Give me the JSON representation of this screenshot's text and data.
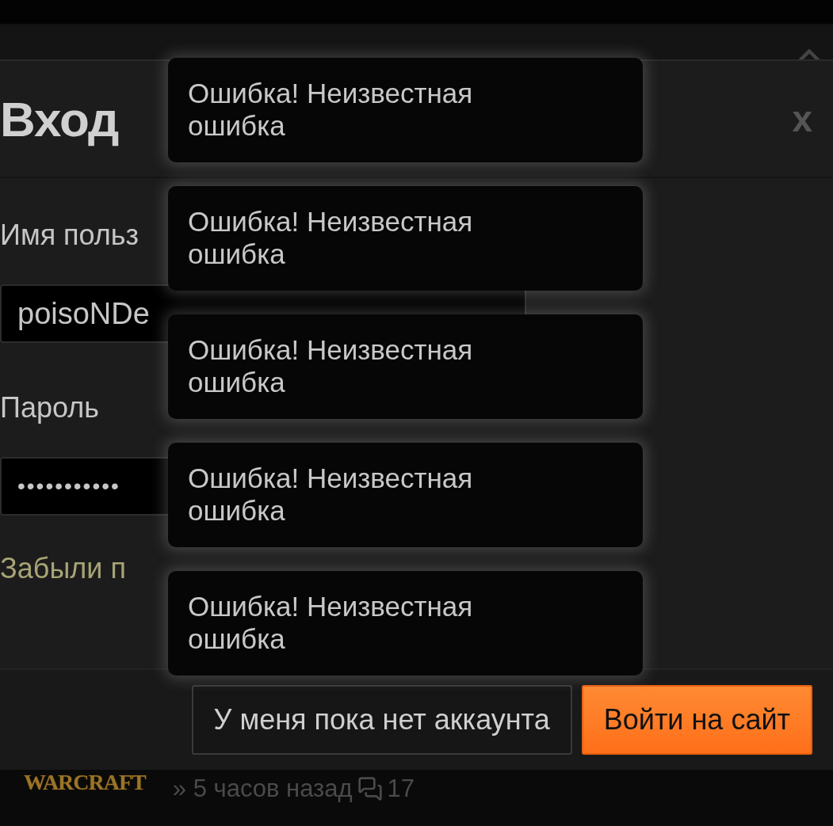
{
  "modal": {
    "title": "Вход",
    "close": "x",
    "fields": [
      {
        "kind": "text",
        "label": "Имя польз",
        "value": "poisoNDe"
      },
      {
        "kind": "password",
        "label": "Пароль",
        "value": "•••••••••••"
      }
    ],
    "forgot_link": "Забыли п",
    "buttons": [
      {
        "kind": "secondary",
        "label": "У меня пока нет аккаунта"
      },
      {
        "kind": "primary",
        "label": "Войти на сайт"
      }
    ]
  },
  "toasts": [
    {
      "message": "Ошибка! Неизвестная ошибка"
    },
    {
      "message": "Ошибка! Неизвестная ошибка"
    },
    {
      "message": "Ошибка! Неизвестная ошибка"
    },
    {
      "message": "Ошибка! Неизвестная ошибка"
    },
    {
      "message": "Ошибка! Неизвестная ошибка"
    }
  ],
  "news_item": {
    "logo": "WARCRAFT",
    "time": "» 5 часов назад",
    "comments": "17"
  }
}
